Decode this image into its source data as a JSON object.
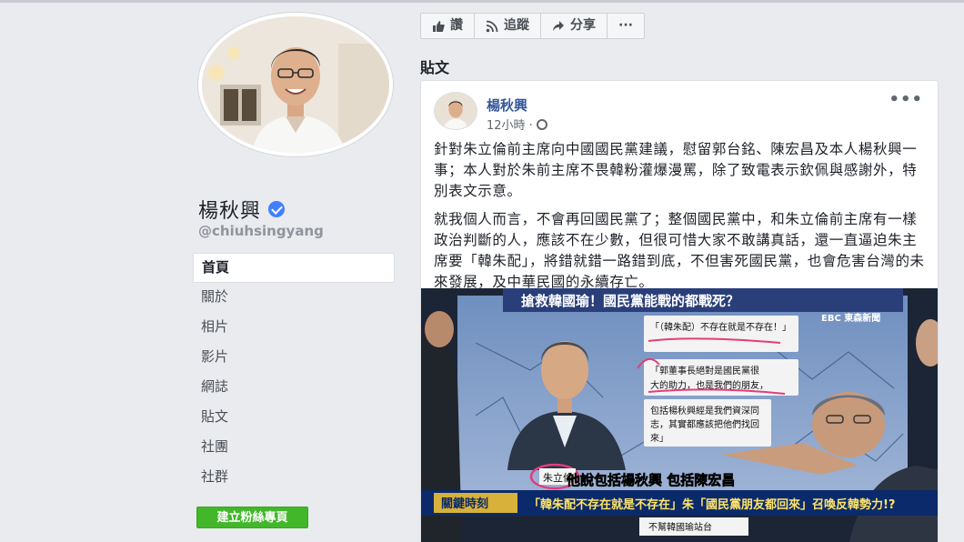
{
  "profile": {
    "name": "楊秋興",
    "handle": "@chiuhsingyang"
  },
  "nav": {
    "items": [
      "首頁",
      "關於",
      "相片",
      "影片",
      "網誌",
      "貼文",
      "社團",
      "社群"
    ]
  },
  "create_page_button": "建立粉絲專頁",
  "actions": {
    "like": "讚",
    "follow": "追蹤",
    "share": "分享",
    "more": "···"
  },
  "section_title": "貼文",
  "post": {
    "author": "楊秋興",
    "time": "12小時 ·",
    "more": "•••",
    "paragraphs": [
      "針對朱立倫前主席向中國國民黨建議，慰留郭台銘、陳宏昌及本人楊秋興一事；本人對於朱前主席不畏韓粉灌爆漫罵，除了致電表示欽佩與感謝外，特別表文示意。",
      "就我個人而言，不會再回國民黨了；整個國民黨中，和朱立倫前主席有一樣政治判斷的人，應該不在少數，但很可惜大家不敢講真話，還一直逼迫朱主席要「韓朱配」，將錯就錯一路錯到底，不但害死國民黨，也會危害台灣的未來發展，及中華民國的永續存亡。"
    ],
    "media": {
      "top_banner": "搶救韓國瑜！國民黨能戰的都戰死？",
      "channel": "EBC 東森新聞",
      "bubble_1": "「（韓朱配）不存在就是不存在！」",
      "bubble_2a": "「郭董事長絕對是國民黨很",
      "bubble_2b": "大的助力，也是我們的朋友，",
      "bubble_3a": "包括楊秋興經是我們資深同",
      "bubble_3b": "志，其實都應該把他們找回",
      "bubble_3c": "來」",
      "name_tag": "朱立倫",
      "subtitle": "他說包括楊秋興 包括陳宏昌",
      "bar_label": "關鍵時刻",
      "bar_text": "「韓朱配不存在就是不存在」朱「國民黨朋友都回來」召喚反韓勢力!?",
      "bottom_tag": "不幫韓國瑜站台"
    }
  },
  "colors": {
    "brand_blue": "#4267b2",
    "link_blue": "#365899",
    "green": "#42b72a",
    "bg": "#e9ebee"
  }
}
